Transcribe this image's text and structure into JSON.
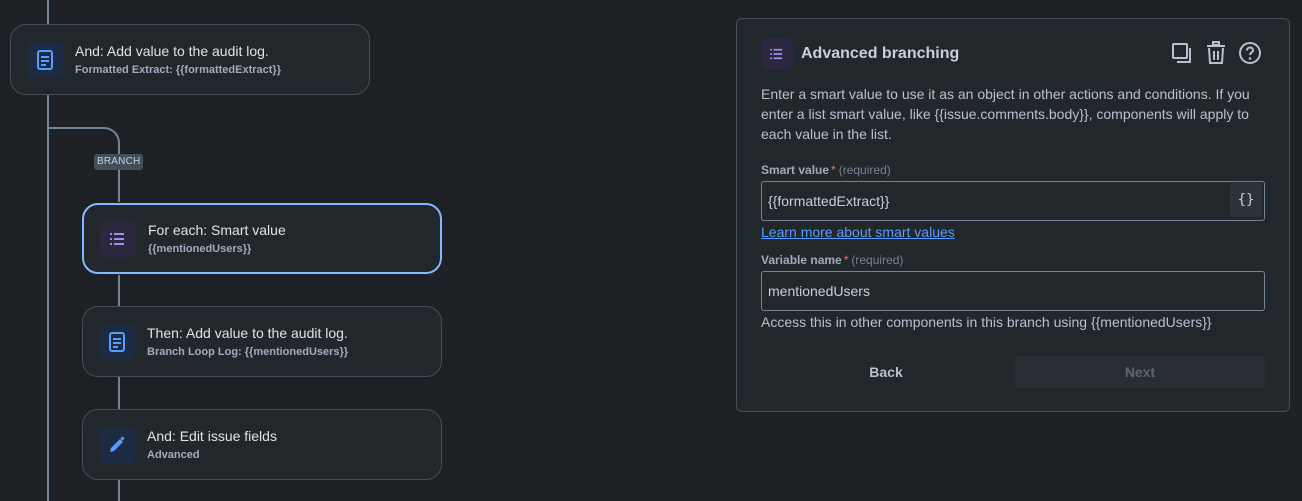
{
  "flow": {
    "branch_label": "BRANCH",
    "audit_card": {
      "title": "And: Add value to the audit log.",
      "subtitle": "Formatted Extract: {{formattedExtract}}",
      "icon": "document-icon"
    },
    "foreach_card": {
      "title": "For each: Smart value",
      "subtitle": "{{mentionedUsers}}",
      "icon": "list-icon"
    },
    "then_card": {
      "title": "Then: Add value to the audit log.",
      "subtitle": "Branch Loop Log: {{mentionedUsers}}",
      "icon": "document-icon"
    },
    "edit_card": {
      "title": "And: Edit issue fields",
      "subtitle": "Advanced",
      "icon": "pencil-icon"
    }
  },
  "panel": {
    "title": "Advanced branching",
    "icon": "list-icon",
    "actions": [
      "copy-icon",
      "trash-icon",
      "help-icon"
    ],
    "description": "Enter a smart value to use it as an object in other actions and conditions. If you enter a list smart value, like {{issue.comments.body}}, components will apply to each value in the list.",
    "smart_value": {
      "label": "Smart value",
      "required_mark": "*",
      "required_text": "(required)",
      "value": "{{formattedExtract}}",
      "button": "{}"
    },
    "learn_more": "Learn more about smart values",
    "variable_name": {
      "label": "Variable name",
      "required_mark": "*",
      "required_text": "(required)",
      "value": "mentionedUsers",
      "helper": "Access this in other components in this branch using {{mentionedUsers}}"
    },
    "back_label": "Back",
    "next_label": "Next"
  },
  "colors": {
    "background": "#1d2125",
    "card": "#22272b",
    "selected_border": "#85b8ff",
    "link": "#579dff",
    "required": "#f87168",
    "icon_blue": "#579dff",
    "icon_purple": "#9f8fef"
  }
}
